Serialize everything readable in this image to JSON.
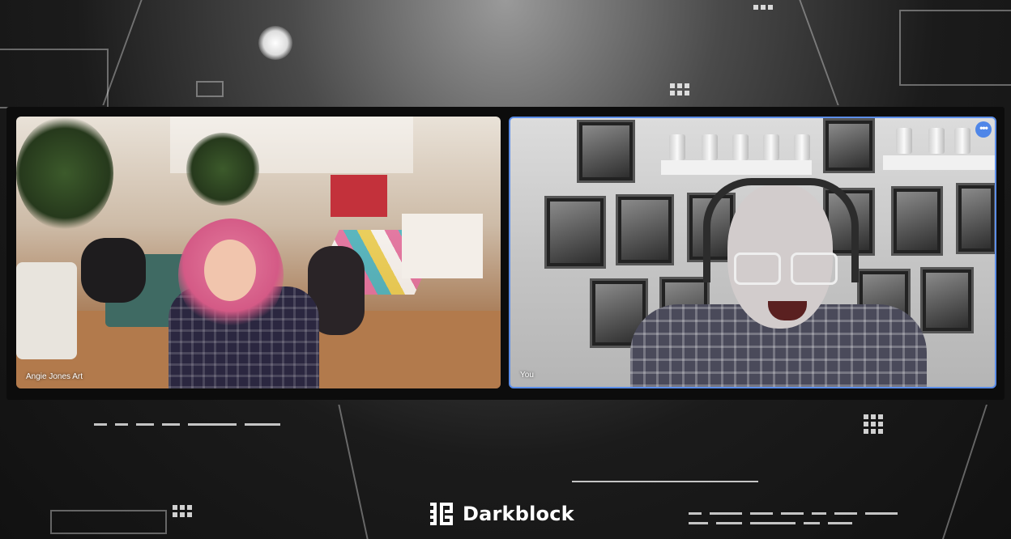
{
  "meeting": {
    "participants": [
      {
        "label": "Angie Jones Art",
        "is_self": false
      },
      {
        "label": "You",
        "is_self": true
      }
    ],
    "more_options_icon": "more-horizontal-icon",
    "active_speaker_border_color": "#5b8de8"
  },
  "brand": {
    "name": "Darkblock",
    "logo_icon": "darkblock-logo-icon"
  },
  "colors": {
    "accent": "#4f86e8",
    "background": "#141414",
    "panel": "#0c0c0c"
  }
}
